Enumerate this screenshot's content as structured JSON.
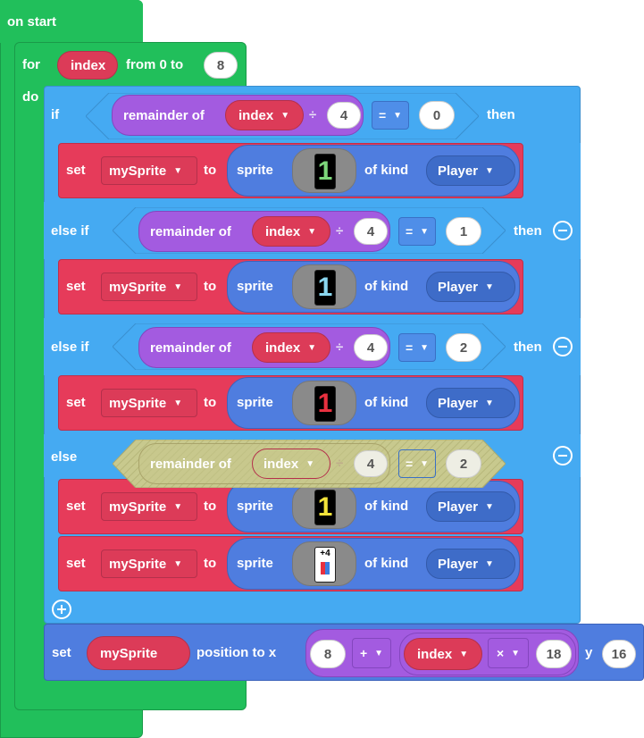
{
  "on_start": {
    "label": "on start"
  },
  "for_loop": {
    "for_label": "for",
    "var": "index",
    "from_label": "from 0 to",
    "to_value": "8",
    "do_label": "do"
  },
  "if_block": {
    "if_label": "if",
    "then_label": "then",
    "else_if_label": "else if",
    "else_label": "else",
    "remainder_label": "remainder of",
    "divide_symbol": "÷",
    "divisor": "4",
    "equals_op": "=",
    "conditions": [
      "0",
      "1",
      "2",
      "2"
    ]
  },
  "set_block": {
    "set_label": "set",
    "var": "mySprite",
    "to_label": "to",
    "sprite_label": "sprite",
    "of_kind_label": "of kind",
    "kind": "Player"
  },
  "cards": [
    {
      "color": "#7cd67a",
      "label": "1"
    },
    {
      "color": "#8ad7f0",
      "label": "1"
    },
    {
      "color": "#e8303f",
      "label": "1"
    },
    {
      "color": "#f3e33a",
      "label": "1"
    },
    {
      "color": "#ffffff",
      "label": "+4"
    }
  ],
  "position_block": {
    "set_label": "set",
    "var": "mySprite",
    "position_label": "position to x",
    "x_value": "8",
    "plus_op": "+",
    "index_var": "index",
    "times_op": "×",
    "multiplier": "18",
    "y_label": "y",
    "y_value": "16"
  },
  "colors": {
    "green": "#21bf5b",
    "blue": "#45aaf2",
    "red": "#e63b5a",
    "purple": "#a35be0",
    "sprite_blue": "#4f7ddf"
  }
}
